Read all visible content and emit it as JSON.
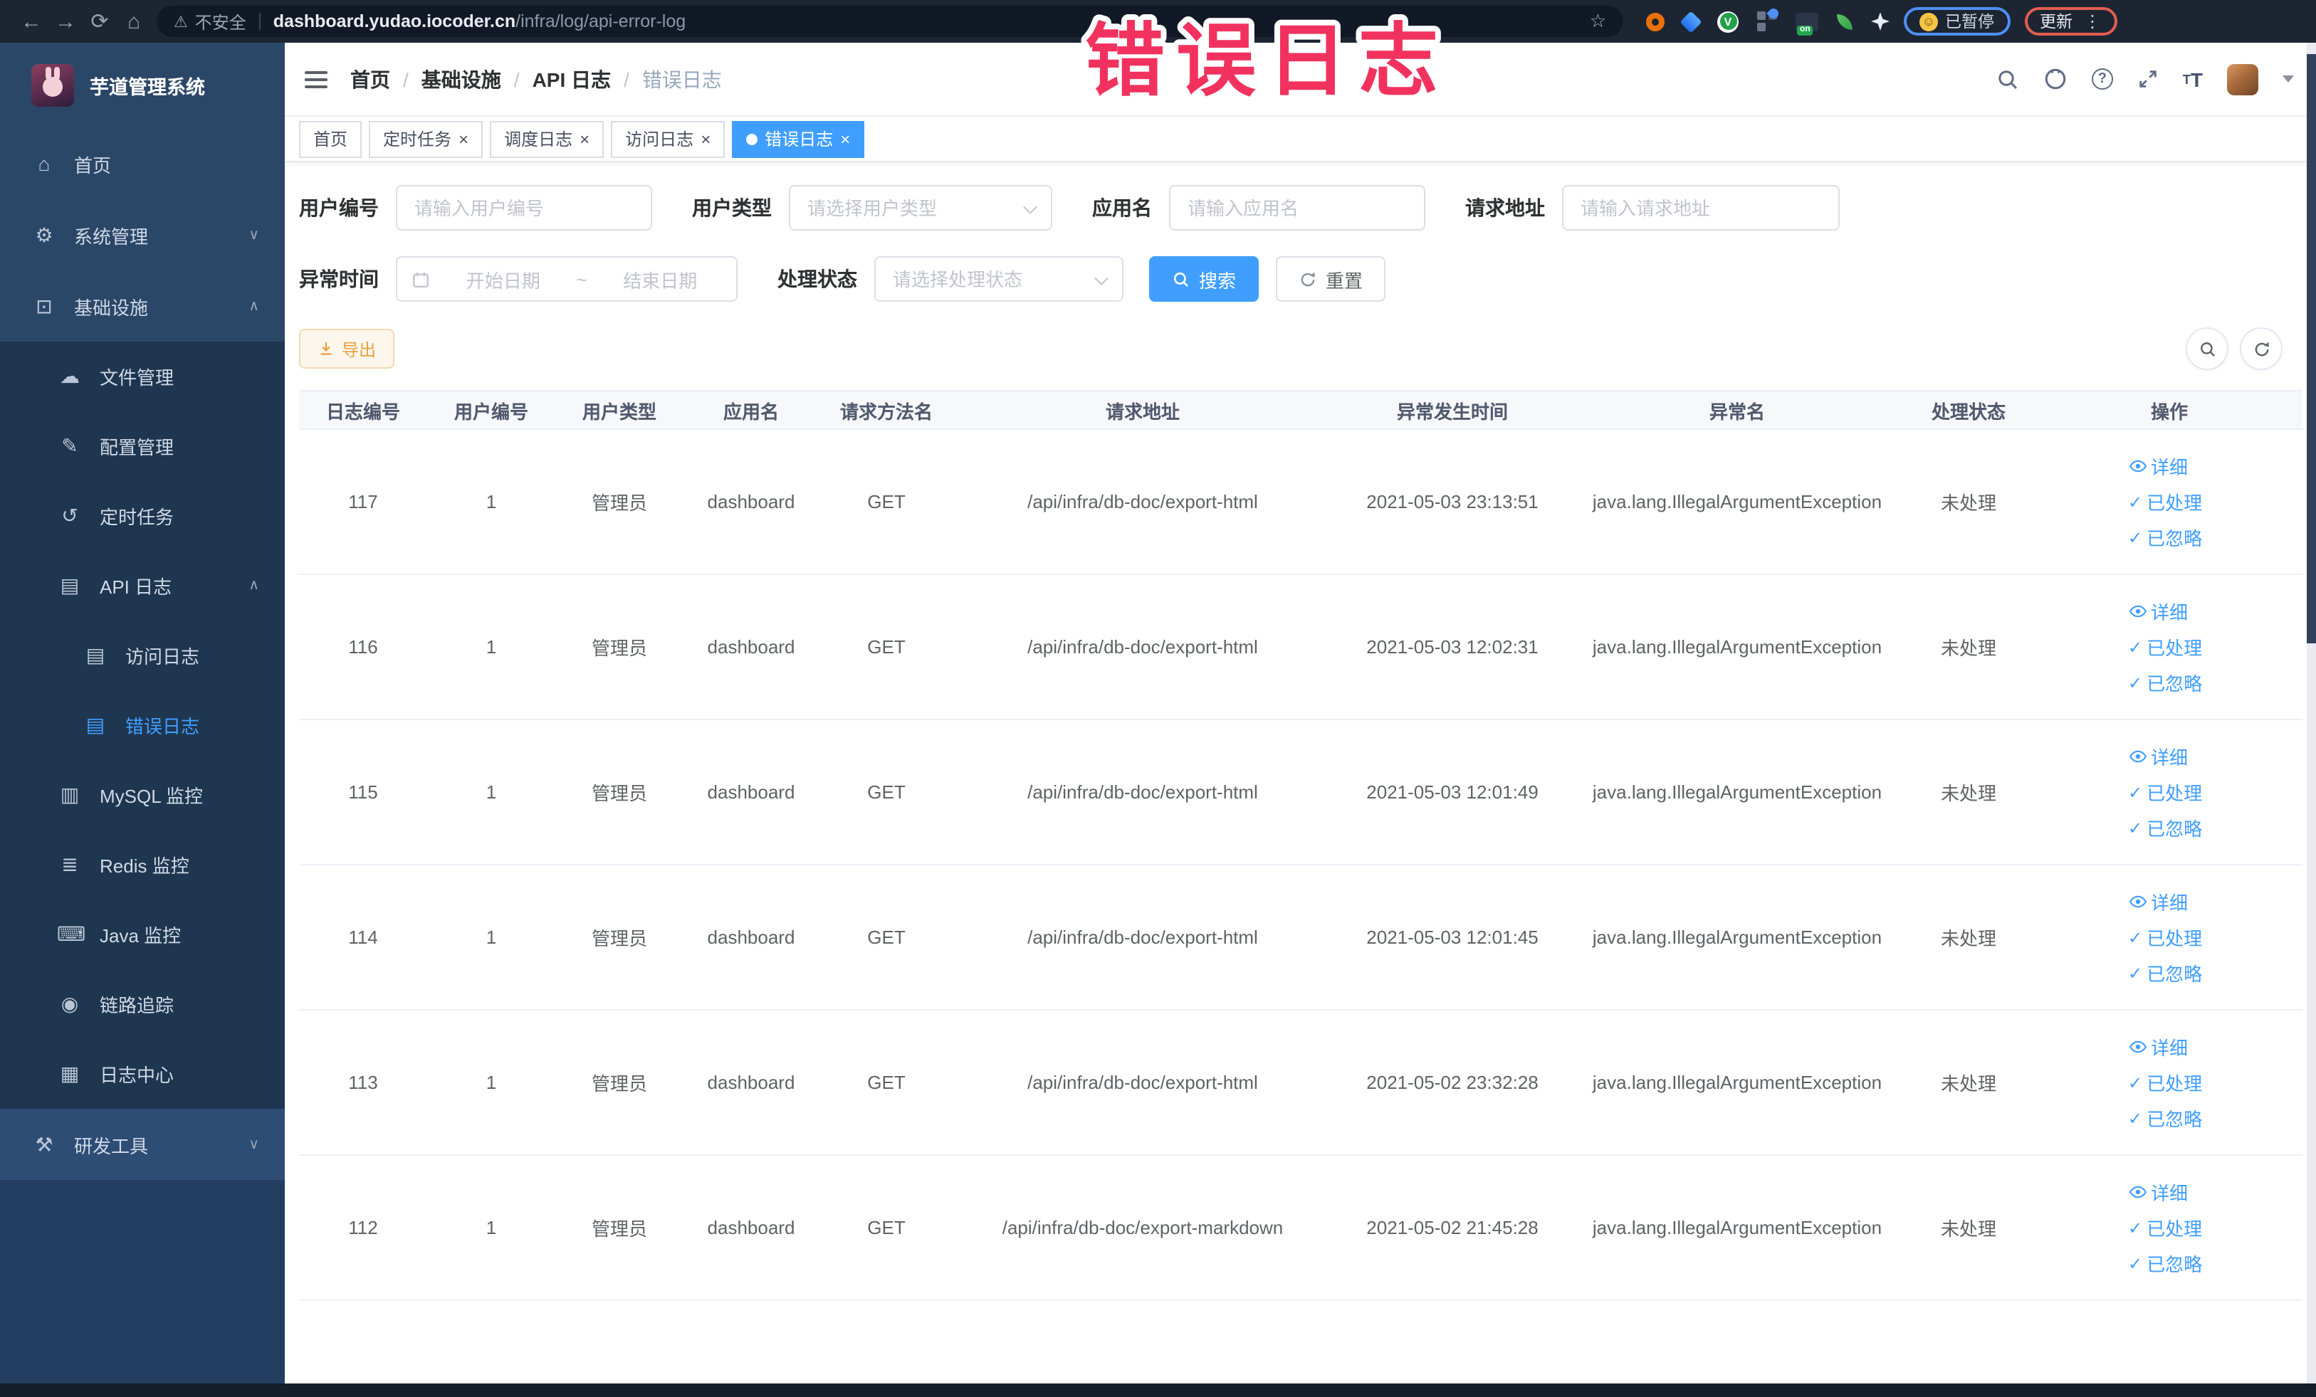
{
  "browser": {
    "warning": "不安全",
    "url_host": "dashboard.yudao.iocoder.cn",
    "url_path": "/infra/log/api-error-log",
    "paused_chip": "已暂停",
    "update_chip": "更新"
  },
  "icons": {
    "back": "←",
    "forward": "→",
    "reload": "⟳",
    "home": "⌂",
    "warn": "⚠",
    "star": "☆",
    "kebab": "⋮",
    "smile": "☺",
    "on_badge": "on",
    "v_badge": "V",
    "close": "×",
    "check": "✓",
    "question": "?",
    "font_small": "T",
    "font_big": "T"
  },
  "annotation": {
    "text": "错误日志",
    "color": "#f2325e"
  },
  "sidebar": {
    "title": "芋道管理系统",
    "items": [
      {
        "label": "首页",
        "icon": "home",
        "level": 0
      },
      {
        "label": "系统管理",
        "icon": "gear",
        "level": 0,
        "chev": "∨"
      },
      {
        "label": "基础设施",
        "icon": "infra",
        "level": 0,
        "chev": "∧"
      },
      {
        "label": "文件管理",
        "icon": "cloud",
        "level": 1,
        "sub": true
      },
      {
        "label": "配置管理",
        "icon": "edit",
        "level": 1,
        "sub": true
      },
      {
        "label": "定时任务",
        "icon": "job",
        "level": 1,
        "sub": true
      },
      {
        "label": "API 日志",
        "icon": "doc",
        "level": 1,
        "sub": true,
        "chev": "∧"
      },
      {
        "label": "访问日志",
        "icon": "doc",
        "level": 2,
        "sub": true
      },
      {
        "label": "错误日志",
        "icon": "doc",
        "level": 2,
        "sub": true,
        "active": true
      },
      {
        "label": "MySQL 监控",
        "icon": "mysql",
        "level": 1,
        "sub": true
      },
      {
        "label": "Redis 监控",
        "icon": "redis",
        "level": 1,
        "sub": true
      },
      {
        "label": "Java 监控",
        "icon": "java",
        "level": 1,
        "sub": true
      },
      {
        "label": "链路追踪",
        "icon": "trace",
        "level": 1,
        "sub": true
      },
      {
        "label": "日志中心",
        "icon": "logcenter",
        "level": 1,
        "sub": true
      },
      {
        "label": "研发工具",
        "icon": "tools",
        "level": 0,
        "lighter": true,
        "chev": "∨"
      }
    ]
  },
  "header": {
    "breadcrumb": [
      {
        "label": "首页"
      },
      {
        "label": "基础设施"
      },
      {
        "label": "API 日志"
      },
      {
        "label": "错误日志",
        "current": true
      }
    ]
  },
  "tabs": [
    {
      "label": "首页"
    },
    {
      "label": "定时任务",
      "closable": true
    },
    {
      "label": "调度日志",
      "closable": true
    },
    {
      "label": "访问日志",
      "closable": true
    },
    {
      "label": "错误日志",
      "closable": true,
      "active": true
    }
  ],
  "filters": {
    "user_id": {
      "label": "用户编号",
      "placeholder": "请输入用户编号"
    },
    "user_type": {
      "label": "用户类型",
      "placeholder": "请选择用户类型"
    },
    "app_name": {
      "label": "应用名",
      "placeholder": "请输入应用名"
    },
    "req_url": {
      "label": "请求地址",
      "placeholder": "请输入请求地址"
    },
    "time": {
      "label": "异常时间",
      "start_placeholder": "开始日期",
      "separator": "~",
      "end_placeholder": "结束日期"
    },
    "status": {
      "label": "处理状态",
      "placeholder": "请选择处理状态"
    },
    "search_label": "搜索",
    "reset_label": "重置"
  },
  "toolbar": {
    "export_label": "导出"
  },
  "table": {
    "columns": [
      "日志编号",
      "用户编号",
      "用户类型",
      "应用名",
      "请求方法名",
      "请求地址",
      "异常发生时间",
      "异常名",
      "处理状态",
      "操作"
    ],
    "row_actions": [
      "详细",
      "已处理",
      "已忽略"
    ],
    "rows": [
      {
        "id": "117",
        "uid": "1",
        "utype": "管理员",
        "app": "dashboard",
        "method": "GET",
        "url": "/api/infra/db-doc/export-html",
        "time": "2021-05-03 23:13:51",
        "exc": "java.lang.IllegalArgumentException",
        "status": "未处理"
      },
      {
        "id": "116",
        "uid": "1",
        "utype": "管理员",
        "app": "dashboard",
        "method": "GET",
        "url": "/api/infra/db-doc/export-html",
        "time": "2021-05-03 12:02:31",
        "exc": "java.lang.IllegalArgumentException",
        "status": "未处理"
      },
      {
        "id": "115",
        "uid": "1",
        "utype": "管理员",
        "app": "dashboard",
        "method": "GET",
        "url": "/api/infra/db-doc/export-html",
        "time": "2021-05-03 12:01:49",
        "exc": "java.lang.IllegalArgumentException",
        "status": "未处理"
      },
      {
        "id": "114",
        "uid": "1",
        "utype": "管理员",
        "app": "dashboard",
        "method": "GET",
        "url": "/api/infra/db-doc/export-html",
        "time": "2021-05-03 12:01:45",
        "exc": "java.lang.IllegalArgumentException",
        "status": "未处理"
      },
      {
        "id": "113",
        "uid": "1",
        "utype": "管理员",
        "app": "dashboard",
        "method": "GET",
        "url": "/api/infra/db-doc/export-html",
        "time": "2021-05-02 23:32:28",
        "exc": "java.lang.IllegalArgumentException",
        "status": "未处理"
      },
      {
        "id": "112",
        "uid": "1",
        "utype": "管理员",
        "app": "dashboard",
        "method": "GET",
        "url": "/api/infra/db-doc/export-markdown",
        "time": "2021-05-02 21:45:28",
        "exc": "java.lang.IllegalArgumentException",
        "status": "未处理"
      }
    ]
  },
  "colors": {
    "primary": "#409EFF",
    "warning": "#E6A23C",
    "sidebar": "#2b4768",
    "topbar": "#1d2532"
  }
}
